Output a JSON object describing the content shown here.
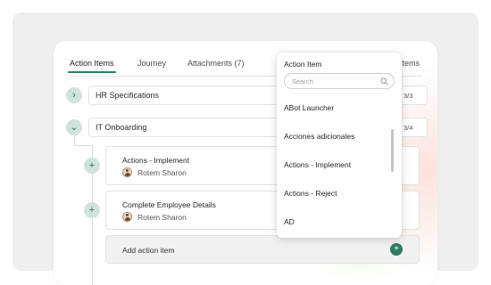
{
  "tabs": [
    {
      "label": "Action Items"
    },
    {
      "label": "Journey"
    },
    {
      "label": "Attachments (7)"
    }
  ],
  "tab_right_label": "Items",
  "rows": [
    {
      "label": "HR Specifications",
      "toggle": "›",
      "count": "3/3"
    },
    {
      "label": "IT Onboarding",
      "toggle": "⌄",
      "count": "3/4"
    }
  ],
  "tasks": [
    {
      "title": "Actions - Implement",
      "assignee": "Rotem Sharon"
    },
    {
      "title": "Complete Employee Details",
      "assignee": "Rotem Sharon"
    }
  ],
  "add_action": {
    "label": "Add action item",
    "icon": "+"
  },
  "dropdown": {
    "header": "Action Item",
    "search_placeholder": "Search",
    "items": [
      "ABot Launcher",
      "Acciones adicionales",
      "Actions - Implement",
      "Actions - Reject",
      "AD"
    ]
  },
  "colors": {
    "accent": "#2e7d62",
    "accent_light": "#cfe3da"
  }
}
